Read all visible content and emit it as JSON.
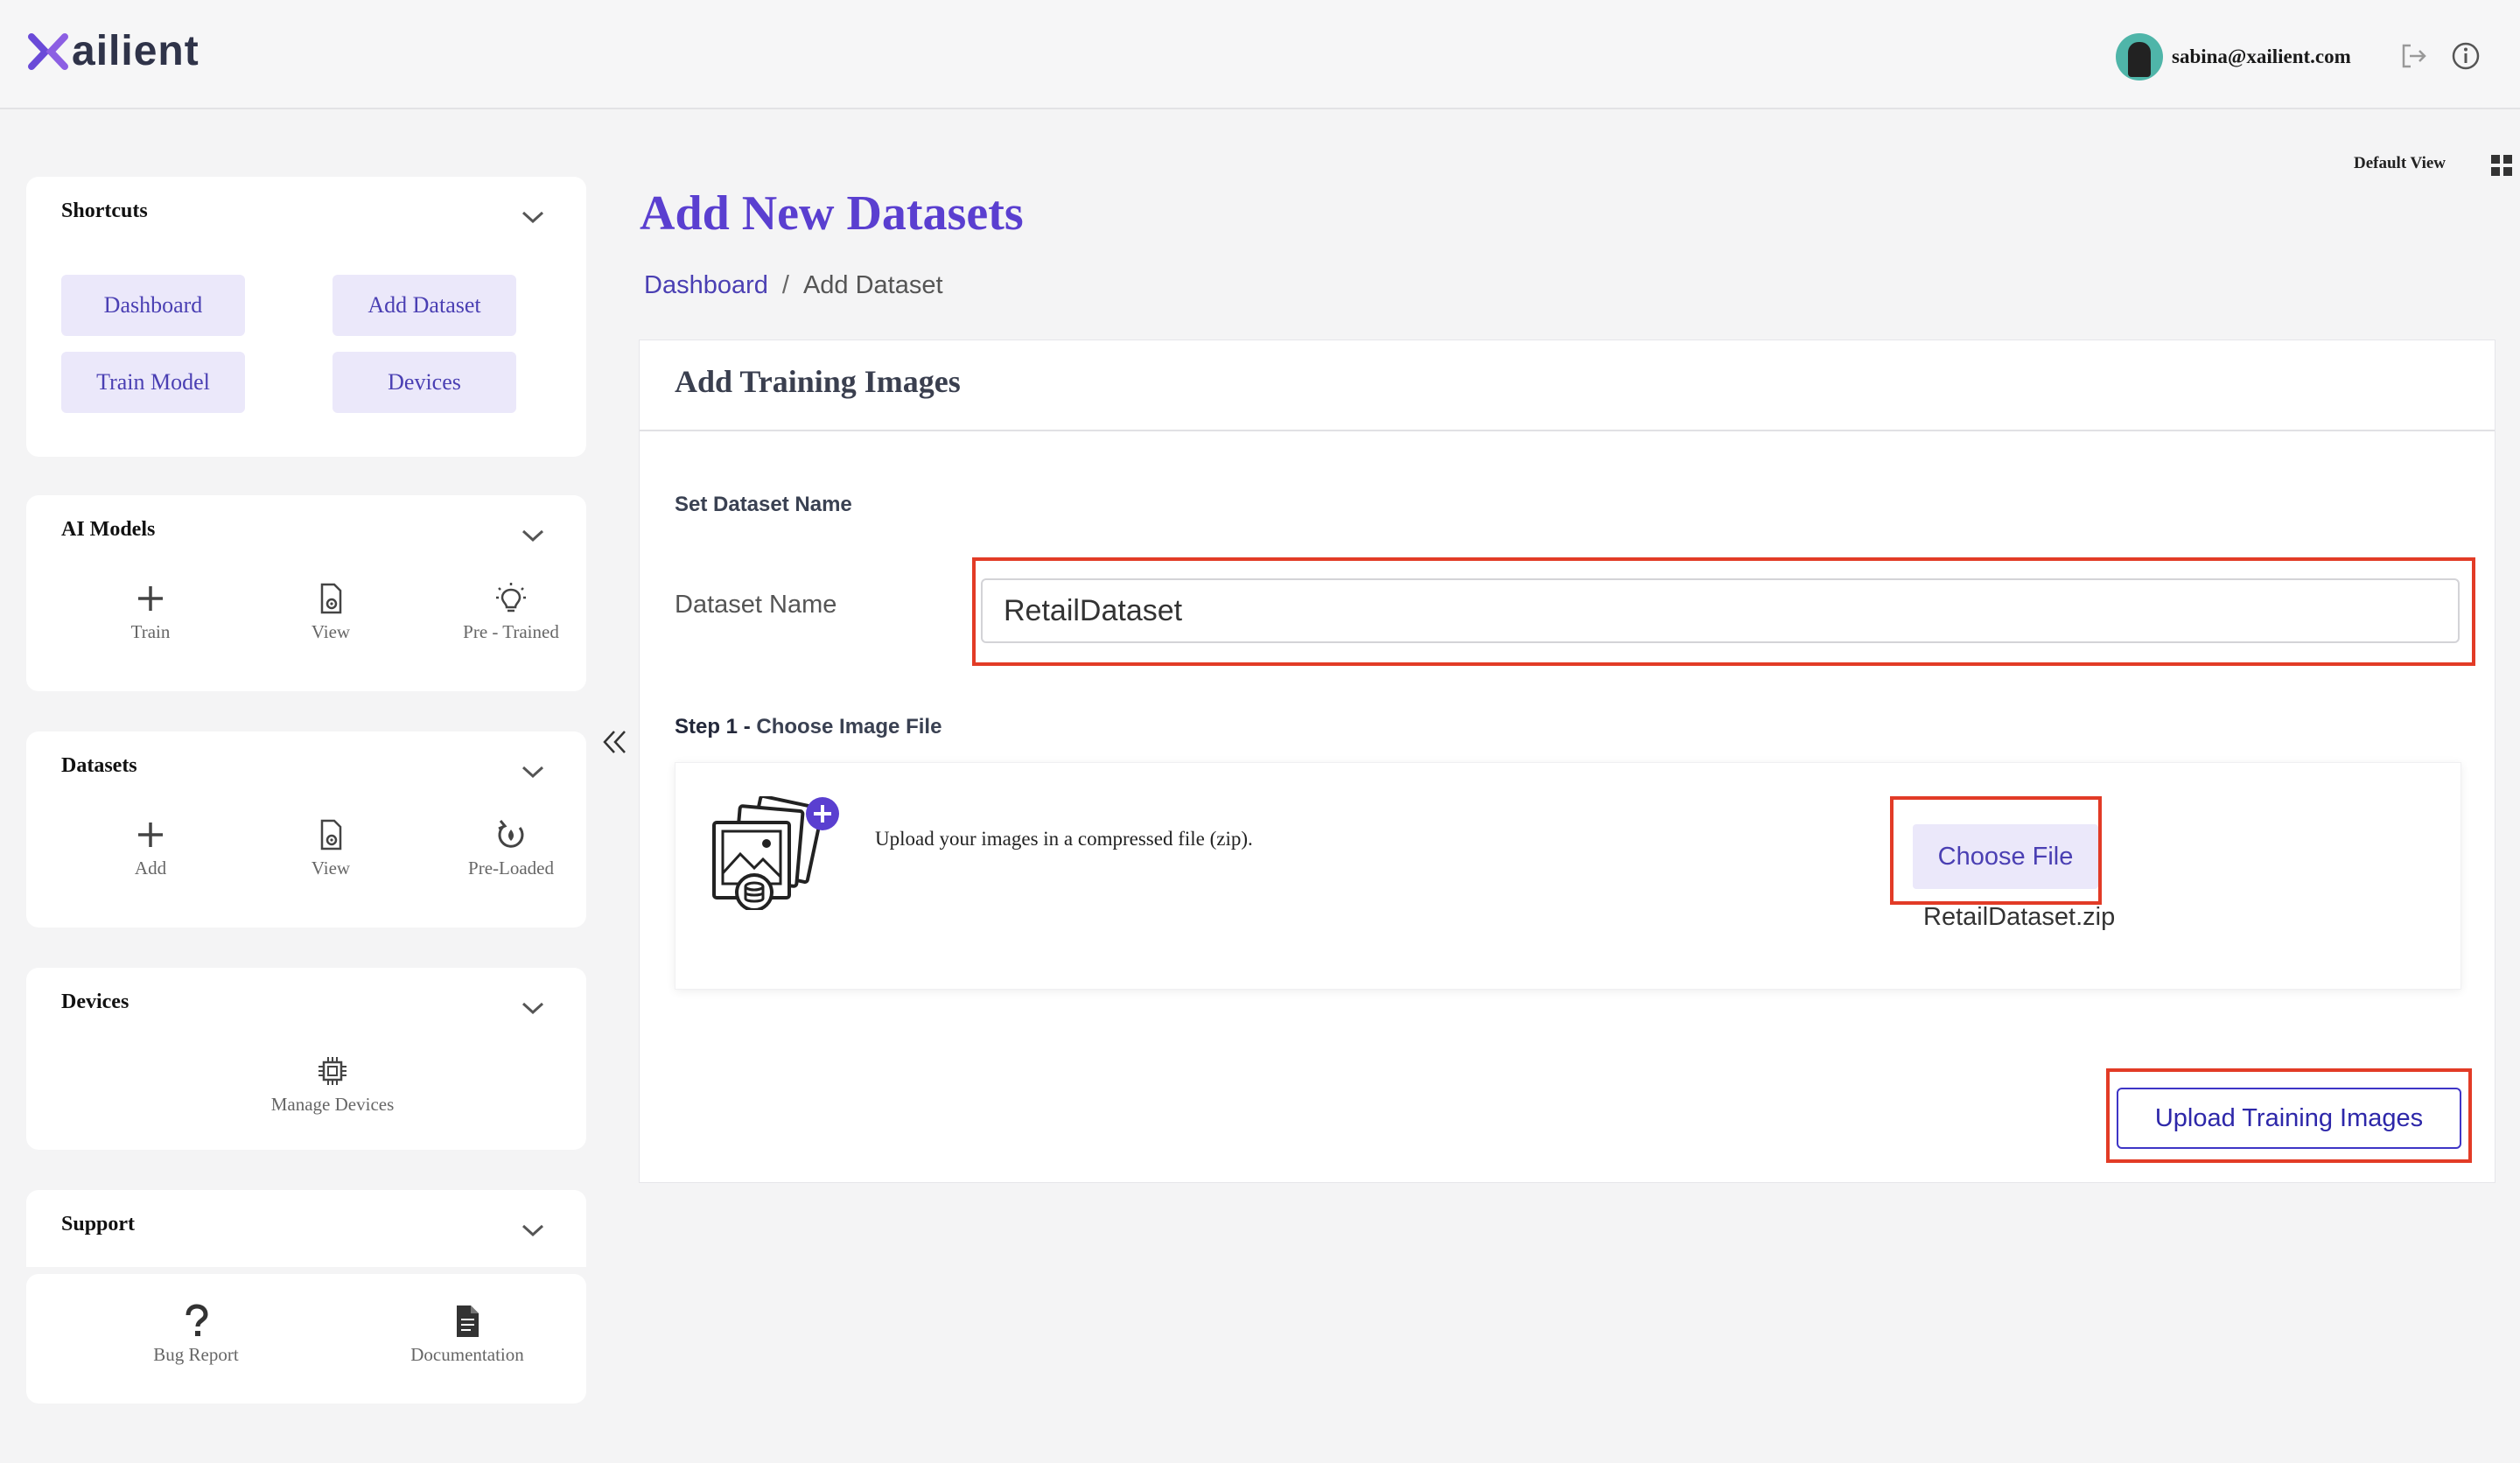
{
  "header": {
    "logo_text": "ailient",
    "user_email": "sabina@xailient.com",
    "brand_color": "#5a3fd0",
    "icons": [
      "logout-icon",
      "info-icon"
    ]
  },
  "sidebar": {
    "shortcuts": {
      "title": "Shortcuts",
      "buttons": [
        "Dashboard",
        "Add Dataset",
        "Train Model",
        "Devices"
      ]
    },
    "ai_models": {
      "title": "AI Models",
      "items": [
        {
          "label": "Train",
          "icon": "plus-icon"
        },
        {
          "label": "View",
          "icon": "file-view-icon"
        },
        {
          "label": "Pre - Trained",
          "icon": "lightbulb-icon"
        }
      ]
    },
    "datasets": {
      "title": "Datasets",
      "items": [
        {
          "label": "Add",
          "icon": "plus-icon"
        },
        {
          "label": "View",
          "icon": "file-view-icon"
        },
        {
          "label": "Pre-Loaded",
          "icon": "refresh-icon"
        }
      ]
    },
    "devices": {
      "title": "Devices",
      "items": [
        {
          "label": "Manage Devices",
          "icon": "chip-icon"
        }
      ]
    },
    "support": {
      "title": "Support",
      "items": [
        {
          "label": "Bug Report",
          "icon": "question-icon"
        },
        {
          "label": "Documentation",
          "icon": "document-icon"
        }
      ]
    }
  },
  "main": {
    "view_toggle": "Default View",
    "page_title": "Add New Datasets",
    "breadcrumb": {
      "link": "Dashboard",
      "separator": "/",
      "current": "Add Dataset"
    },
    "panel": {
      "title": "Add Training Images",
      "set_name_label": "Set Dataset Name",
      "dataset_name_label": "Dataset Name",
      "dataset_name_value": "RetailDataset",
      "step_prefix": "Step 1 - ",
      "step_text": "Choose Image File",
      "upload_instructions": "Upload your images in a compressed file (zip).",
      "choose_file_label": "Choose File",
      "selected_file": "RetailDataset.zip",
      "submit_label": "Upload Training Images"
    }
  },
  "highlight_color": "#e23b26"
}
